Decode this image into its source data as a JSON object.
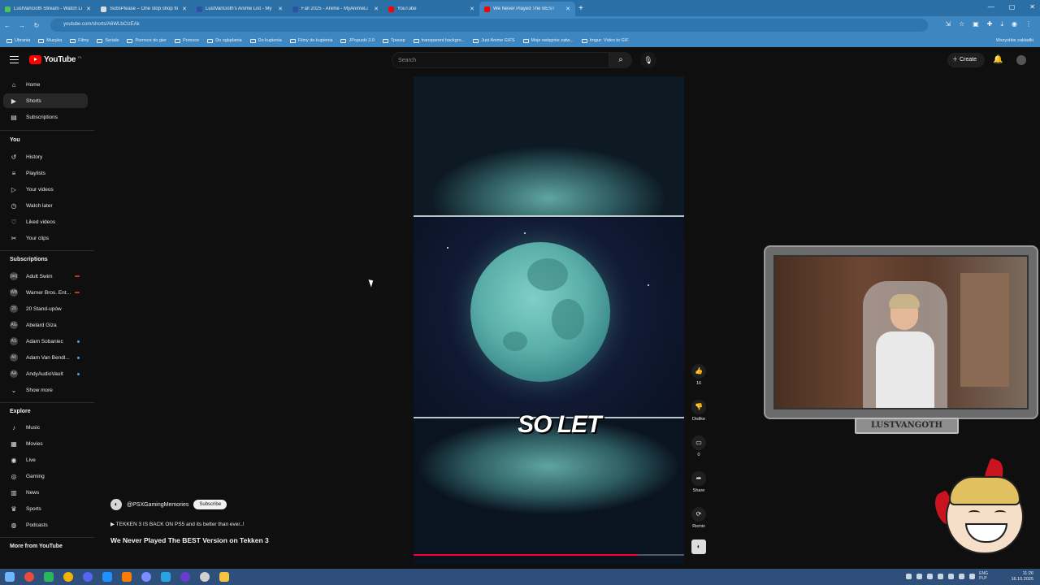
{
  "browser": {
    "tabs": [
      {
        "title": "LustVanGoth Stream - Watch Li",
        "favicon_color": "#4cc25a"
      },
      {
        "title": "SubsPlease – One stop shop fo",
        "favicon_color": "#dddddd"
      },
      {
        "title": "LustVanGoth's Anime List - My",
        "favicon_color": "#2e51a2"
      },
      {
        "title": "Fall 2025 - Anime - MyAnimeLi",
        "favicon_color": "#2e51a2"
      },
      {
        "title": "YouTube",
        "favicon_color": "#ff0000"
      },
      {
        "title": "We Never Played The BEST",
        "favicon_color": "#ff0000",
        "active": true
      }
    ],
    "new_tab": "+",
    "url": "youtube.com/shorts/A6WLbCIzEAk",
    "bookmarks": [
      "Ubrania",
      "Muzyka",
      "Filmy",
      "Seriale",
      "Pomoce do gier",
      "Pomoce",
      "Do oglądania",
      "Do kupienia",
      "Filmy do kupienia",
      "JPopuski 2.0",
      "Трекер",
      "transparent backgro...",
      "Just Anime GIFS",
      "Moje wstępnie zatw...",
      "Imgur: Video to GIF"
    ],
    "bookmarks_all": "Wszystkie zakładki"
  },
  "header": {
    "logo": "YouTube",
    "country": "PL",
    "search_placeholder": "Search",
    "create_label": "Create"
  },
  "sidebar": {
    "main": [
      {
        "label": "Home",
        "icon": "home-icon",
        "glyph": "⌂"
      },
      {
        "label": "Shorts",
        "icon": "shorts-icon",
        "glyph": "▶",
        "active": true
      },
      {
        "label": "Subscriptions",
        "icon": "subscriptions-icon",
        "glyph": "▤"
      }
    ],
    "you_heading": "You",
    "you": [
      {
        "label": "History",
        "glyph": "↺"
      },
      {
        "label": "Playlists",
        "glyph": "≡"
      },
      {
        "label": "Your videos",
        "glyph": "▷"
      },
      {
        "label": "Watch later",
        "glyph": "◷"
      },
      {
        "label": "Liked videos",
        "glyph": "♡"
      },
      {
        "label": "Your clips",
        "glyph": "✂"
      }
    ],
    "subscriptions_heading": "Subscriptions",
    "subscriptions": [
      {
        "label": "Adult Swim",
        "abbr": "[as]",
        "indicator": "live"
      },
      {
        "label": "Warner Bros. Ent...",
        "abbr": "WB",
        "indicator": "live"
      },
      {
        "label": "20 Stand-upów",
        "abbr": "20",
        "indicator": ""
      },
      {
        "label": "Abelard Giza",
        "abbr": "AG",
        "indicator": ""
      },
      {
        "label": "Adam Sobaniec",
        "abbr": "AS",
        "indicator": "new"
      },
      {
        "label": "Adam Van Bendl...",
        "abbr": "AV",
        "indicator": "new"
      },
      {
        "label": "AndyAudioVault",
        "abbr": "AA",
        "indicator": "new"
      }
    ],
    "show_more": "Show more",
    "explore_heading": "Explore",
    "explore": [
      {
        "label": "Music",
        "glyph": "♪"
      },
      {
        "label": "Movies",
        "glyph": "▦"
      },
      {
        "label": "Live",
        "glyph": "◉"
      },
      {
        "label": "Gaming",
        "glyph": "◎"
      },
      {
        "label": "News",
        "glyph": "▥"
      },
      {
        "label": "Sports",
        "glyph": "♛"
      },
      {
        "label": "Podcasts",
        "glyph": "◍"
      }
    ],
    "more_heading": "More from YouTube"
  },
  "short": {
    "caption_white": "SO ",
    "caption_accent": "LET",
    "progress": 0.83,
    "channel": "@PSXGamingMemories",
    "subscribe": "Subscribe",
    "description": "▶ TEKKEN 3 IS BACK ON PS5 and its better than ever..!",
    "title": "We Never Played The BEST Version on Tekken 3"
  },
  "actions": [
    {
      "icon": "like-icon",
      "glyph": "👍",
      "label": "16"
    },
    {
      "icon": "dislike-icon",
      "glyph": "👎",
      "label": "Dislike"
    },
    {
      "icon": "comment-icon",
      "glyph": "▭",
      "label": "0"
    },
    {
      "icon": "share-icon",
      "glyph": "➦",
      "label": "Share"
    },
    {
      "icon": "remix-icon",
      "glyph": "⟳",
      "label": "Remix"
    }
  ],
  "overlay": {
    "nameplate": "LUSTVANGOTH"
  },
  "taskbar": {
    "lang1": "ENG",
    "lang2": "PLP",
    "time": "11:26",
    "date": "16.10.2025"
  }
}
